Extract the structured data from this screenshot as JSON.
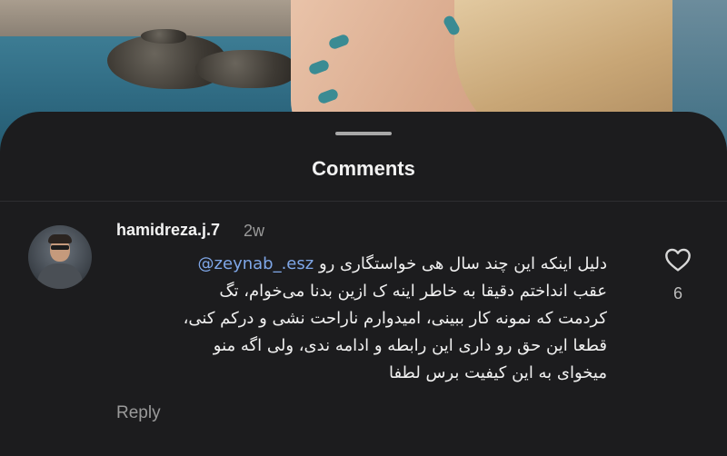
{
  "sheet": {
    "title": "Comments"
  },
  "comment": {
    "username": "hamidreza.j.7",
    "time": "2w",
    "mention": "@zeynab_.esz",
    "lines": [
      "دلیل اینکه این چند سال هی خواستگاری رو",
      "عقب انداختم دقیقا به خاطر اینه ک ازین بدنا می‌خوام، تگ",
      "کردمت که نمونه کار ببینی، امیدوارم ناراحت نشی و درکم کنی،",
      "قطعا این حق رو داری این رابطه و ادامه ندی، ولی اگه منو",
      "میخوای به این کیفیت برس لطفا"
    ],
    "reply_label": "Reply",
    "like_count": "6"
  },
  "icons": {
    "like": "heart-icon",
    "avatar": "avatar"
  },
  "colors": {
    "sheet_bg": "#1c1c1e",
    "mention": "#7fa7e8",
    "muted": "#9a9a9a"
  }
}
